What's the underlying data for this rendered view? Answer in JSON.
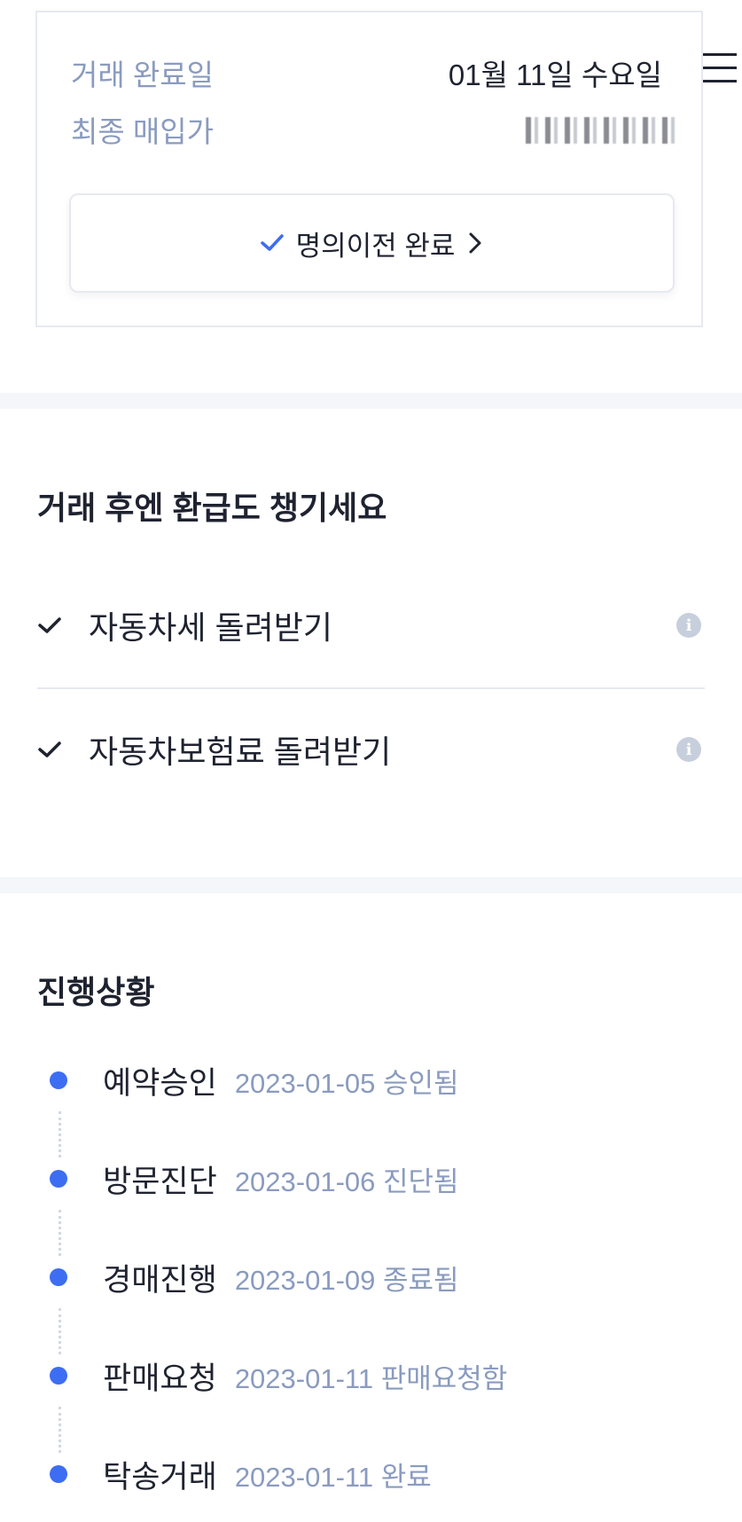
{
  "summary": {
    "date_label": "거래 완료일",
    "date_value": "01월 11일 수요일",
    "price_label": "최종 매입가",
    "transfer_button_label": "명의이전 완료"
  },
  "refund": {
    "title": "거래 후엔 환급도 챙기세요",
    "items": [
      {
        "label": "자동차세 돌려받기"
      },
      {
        "label": "자동차보험료 돌려받기"
      }
    ]
  },
  "progress": {
    "title": "진행상황",
    "steps": [
      {
        "name": "예약승인",
        "detail": "2023-01-05 승인됨"
      },
      {
        "name": "방문진단",
        "detail": "2023-01-06 진단됨"
      },
      {
        "name": "경매진행",
        "detail": "2023-01-09 종료됨"
      },
      {
        "name": "판매요청",
        "detail": "2023-01-11 판매요청함"
      },
      {
        "name": "탁송거래",
        "detail": "2023-01-11 완료"
      }
    ]
  },
  "colors": {
    "accent": "#3d6df2",
    "muted_text": "#8a9bbf",
    "primary_text": "#1f2330",
    "divider": "#e6e9f0",
    "band": "#f4f6f9"
  }
}
